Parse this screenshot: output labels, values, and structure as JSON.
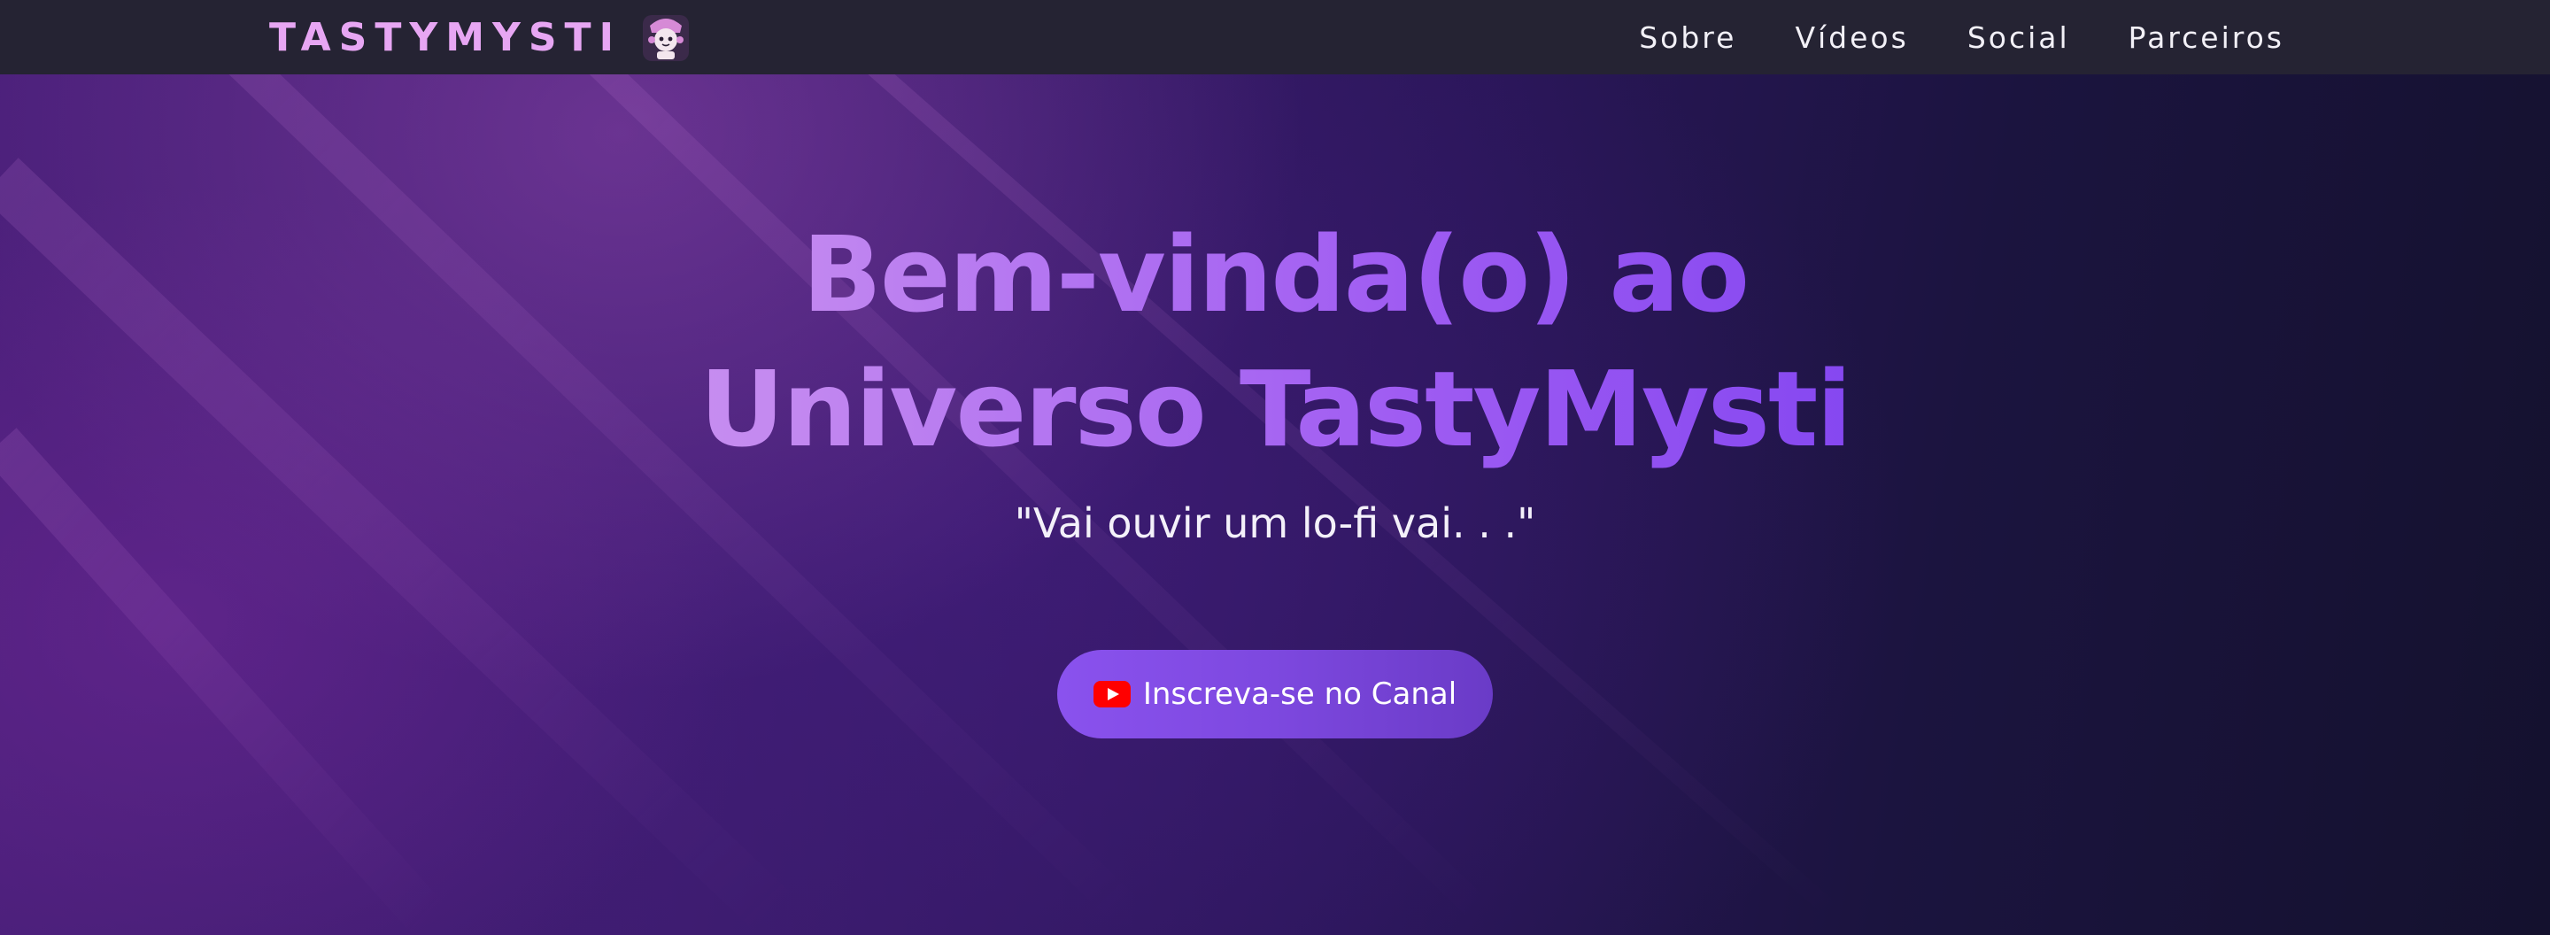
{
  "nav": {
    "brand": "TASTYMYSTI",
    "links": [
      {
        "label": "Sobre"
      },
      {
        "label": "Vídeos"
      },
      {
        "label": "Social"
      },
      {
        "label": "Parceiros"
      }
    ]
  },
  "hero": {
    "title_line1": "Bem-vinda(o) ao",
    "title_line2": "Universo TastyMysti",
    "subtitle": "\"Vai ouvir um lo-fi vai. . .\"",
    "cta_label": "Inscreva-se no Canal",
    "cta_icon": "youtube-icon"
  },
  "colors": {
    "nav_bg": "#252333",
    "brand": "#e7a6f3",
    "title_gradient_start": "#d9a3f2",
    "title_gradient_end": "#7240ee",
    "cta_bg": "#7d48df",
    "youtube_red": "#ff0000"
  }
}
